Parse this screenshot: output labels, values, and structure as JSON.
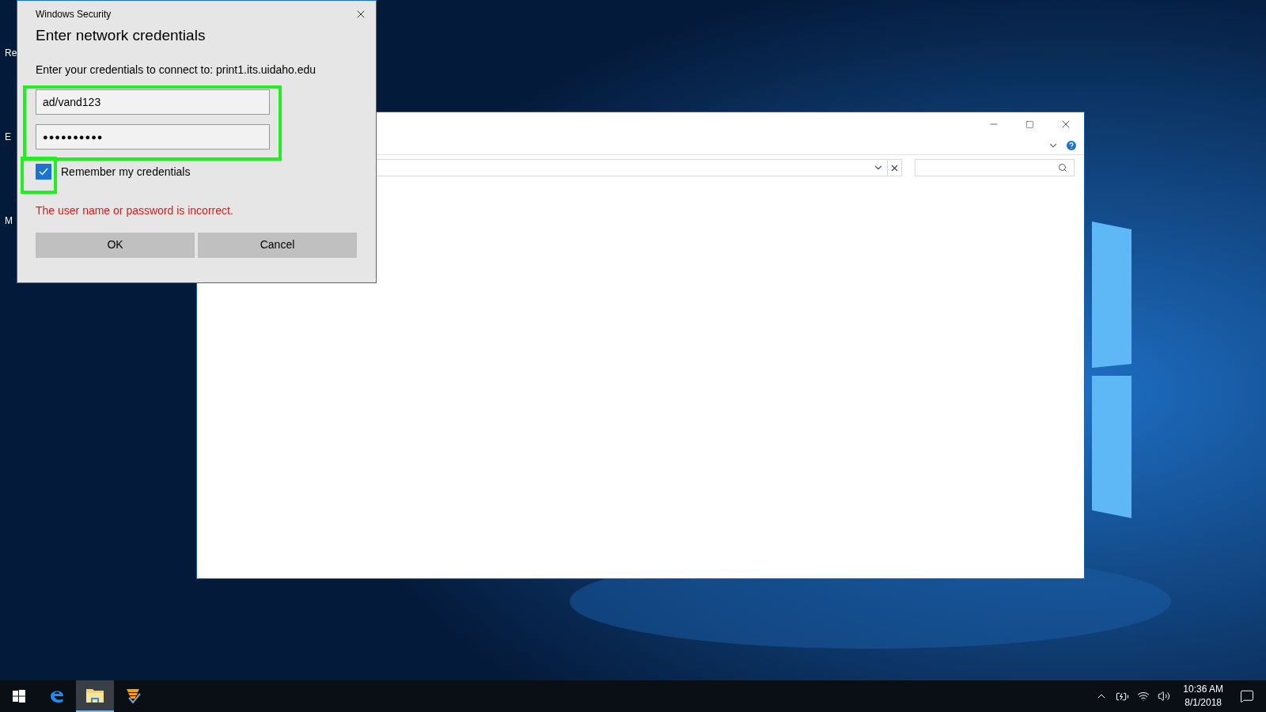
{
  "desktop_icons": [
    {
      "label": "Re"
    },
    {
      "label": "E"
    },
    {
      "label": "M"
    }
  ],
  "dialog": {
    "title": "Windows Security",
    "heading": "Enter network credentials",
    "prompt": "Enter your credentials to connect to: print1.its.uidaho.edu",
    "username": {
      "value": "ad/vand123"
    },
    "password": {
      "value": "●●●●●●●●●●"
    },
    "remember": {
      "label": "Remember my credentials",
      "checked": true
    },
    "error": "The user name or password is incorrect.",
    "buttons": [
      "OK",
      "Cancel"
    ]
  },
  "taskbar": {
    "apps": [
      {
        "kind": "edge",
        "selected": false
      },
      {
        "kind": "folder",
        "selected": true
      },
      {
        "kind": "tool",
        "selected": false
      }
    ],
    "clock": {
      "time": "10:36 AM",
      "date": "8/1/2018"
    }
  }
}
